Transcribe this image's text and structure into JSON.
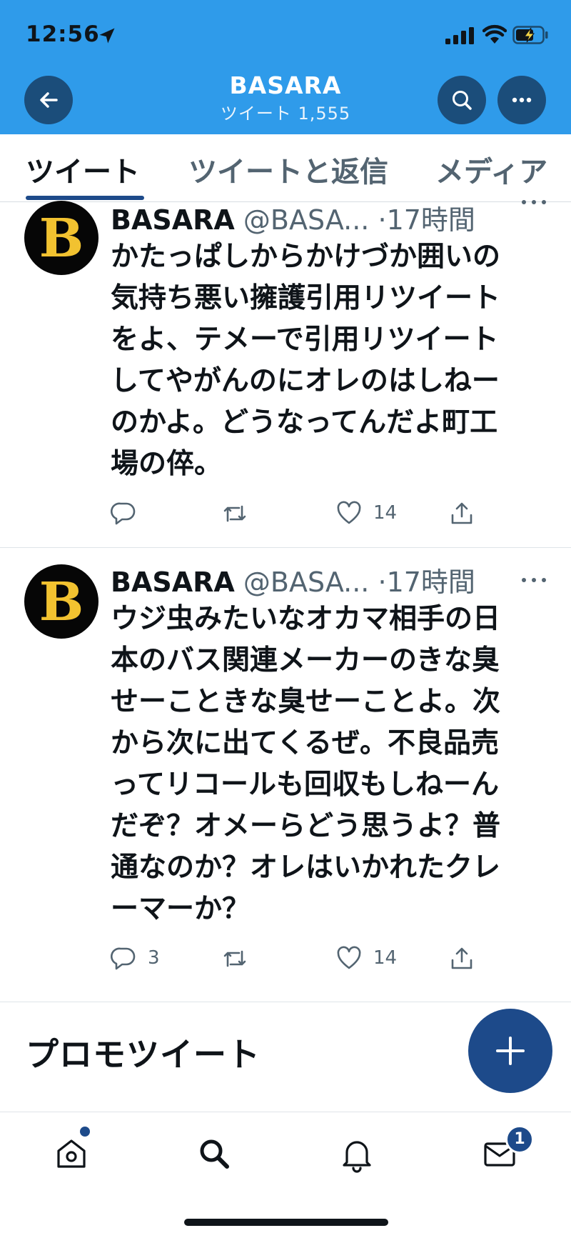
{
  "status_bar": {
    "time": "12:56"
  },
  "header": {
    "title": "BASARA",
    "subtitle": "ツイート 1,555"
  },
  "tabs": [
    {
      "label": "ツイート",
      "active": true
    },
    {
      "label": "ツイートと返信",
      "active": false
    },
    {
      "label": "メディア",
      "active": false
    }
  ],
  "tweets": [
    {
      "name": "BASARA",
      "handle": "@BASA...",
      "time": "·17時間",
      "avatar_letter": "B",
      "lines": [
        "かたっぱしからかけづか囲いの",
        "気持ち悪い擁護引用リツイート",
        "をよ、テメーで引用リツイート",
        "してやがんのにオレのはしねー",
        "のかよ。どうなってんだよ町工",
        "場の倅。"
      ],
      "replies": "",
      "retweets": "",
      "likes": "14"
    },
    {
      "name": "BASARA",
      "handle": "@BASA...",
      "time": "·17時間",
      "avatar_letter": "B",
      "lines": [
        "ウジ虫みたいなオカマ相手の日",
        "本のバス関連メーカーのきな臭",
        "せーこときな臭せーことよ。次",
        "から次に出てくるぜ。不良品売",
        "ってリコールも回収もしねーん",
        "だぞ？オメーらどう思うよ？普",
        "通なのか？オレはいかれたクレ",
        "ーマーか？"
      ],
      "replies": "3",
      "retweets": "",
      "likes": "14"
    }
  ],
  "promo": {
    "title": "プロモツイート"
  },
  "bottom_nav": {
    "messages_badge": "1"
  },
  "colors": {
    "header_bg": "#2f9bea",
    "accent": "#1d4a8a",
    "text": "#0f1419",
    "muted": "#536471"
  }
}
